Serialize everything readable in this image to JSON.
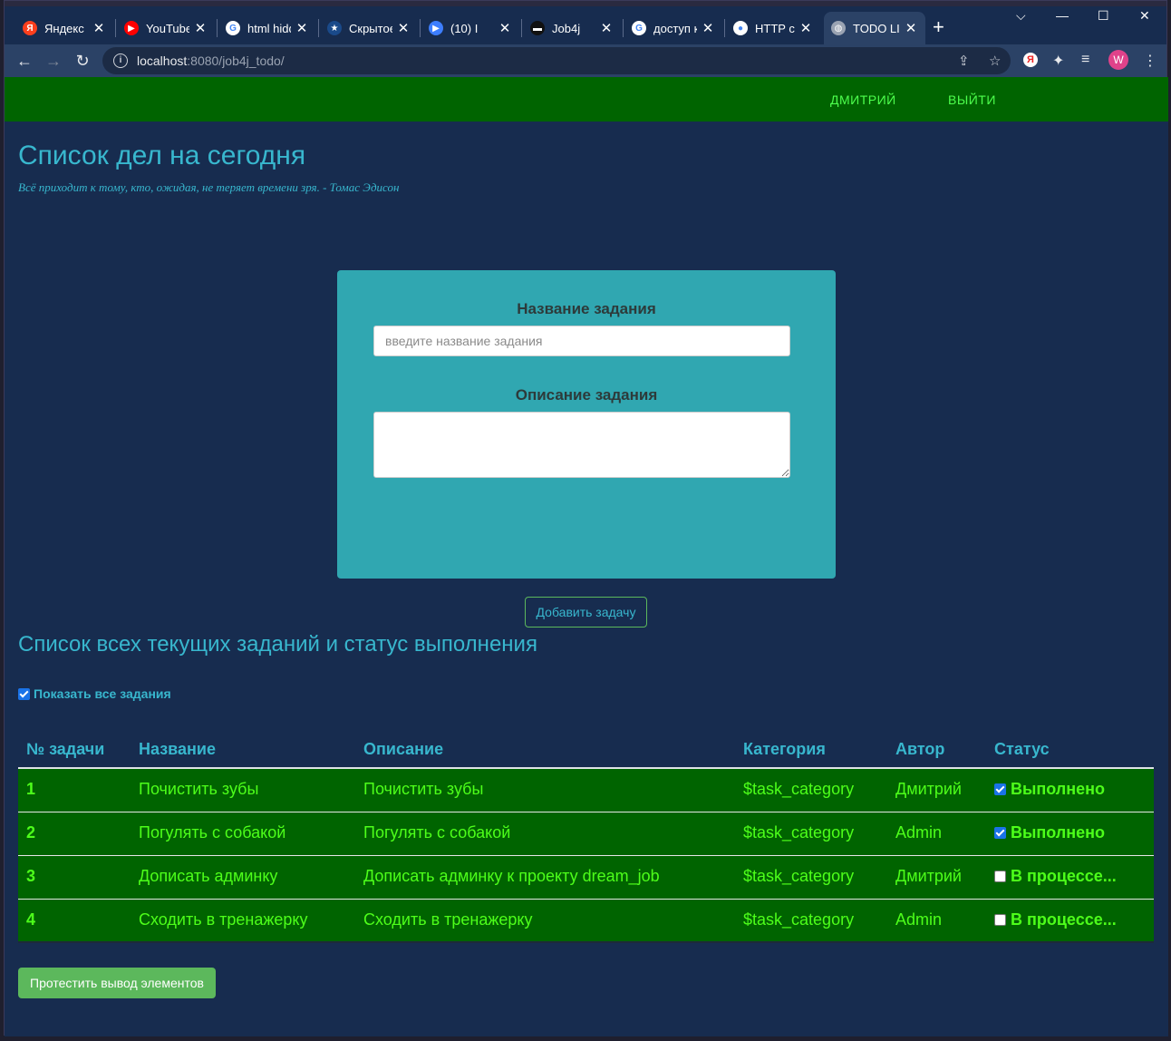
{
  "browser": {
    "tabs": [
      {
        "label": "Яндекс",
        "icon": "yandex-icon",
        "color": "#fc3f1d",
        "glyph": "Я"
      },
      {
        "label": "YouTube",
        "icon": "youtube-icon",
        "color": "#ff0000",
        "glyph": "▶"
      },
      {
        "label": "html hidd",
        "icon": "google-icon",
        "color": "#ffffff",
        "glyph": "G"
      },
      {
        "label": "Скрытое",
        "icon": "star-site-icon",
        "color": "#1a4a8a",
        "glyph": "★"
      },
      {
        "label": "(10) I",
        "icon": "video-icon",
        "color": "#3d7eff",
        "glyph": "▶"
      },
      {
        "label": "Job4j",
        "icon": "job4j-icon",
        "color": "#111111",
        "glyph": "▬"
      },
      {
        "label": "доступ к",
        "icon": "google-icon",
        "color": "#ffffff",
        "glyph": "G"
      },
      {
        "label": "HTTP ce",
        "icon": "github-icon",
        "color": "#ffffff",
        "glyph": "●"
      },
      {
        "label": "TODO LIS",
        "icon": "globe-icon",
        "color": "#9aa3b2",
        "glyph": "◍"
      }
    ],
    "url_host": "localhost",
    "url_rest": ":8080/job4j_todo/",
    "avatar_letter": "W"
  },
  "nav": {
    "user": "ДМИТРИЙ",
    "logout": "ВЫЙТИ"
  },
  "header": {
    "title": "Список дел на сегодня",
    "quote": "Всё приходит к тому, кто, ожидая, не теряет времени зря. - Томас Эдисон"
  },
  "form": {
    "name_label": "Название задания",
    "name_placeholder": "введите название задания",
    "desc_label": "Описание задания",
    "submit": "Добавить задачу"
  },
  "list": {
    "title": "Список всех текущих заданий и статус выполнения",
    "show_all_label": "Показать все задания",
    "show_all_checked": true,
    "columns": [
      "№ задачи",
      "Название",
      "Описание",
      "Категория",
      "Автор",
      "Статус"
    ],
    "rows": [
      {
        "id": "1",
        "name": "Почистить зубы",
        "desc": "Почистить зубы",
        "category": "$task_category",
        "author": "Дмитрий",
        "done": true,
        "status": "Выполнено"
      },
      {
        "id": "2",
        "name": "Погулять с собакой",
        "desc": "Погулять с собакой",
        "category": "$task_category",
        "author": "Admin",
        "done": true,
        "status": "Выполнено"
      },
      {
        "id": "3",
        "name": "Дописать админку",
        "desc": "Дописать админку к проекту dream_job",
        "category": "$task_category",
        "author": "Дмитрий",
        "done": false,
        "status": "В процессе..."
      },
      {
        "id": "4",
        "name": "Сходить в тренажерку",
        "desc": "Сходить в тренажерку",
        "category": "$task_category",
        "author": "Admin",
        "done": false,
        "status": "В процессе..."
      }
    ]
  },
  "test_button": "Протестить вывод элементов",
  "colors": {
    "page_bg": "#172c4f",
    "nav_green": "#006400",
    "accent_cyan": "#38b7ce",
    "form_teal": "#30a7b1",
    "row_text": "#4dff1a",
    "test_btn": "#5cb85c"
  }
}
